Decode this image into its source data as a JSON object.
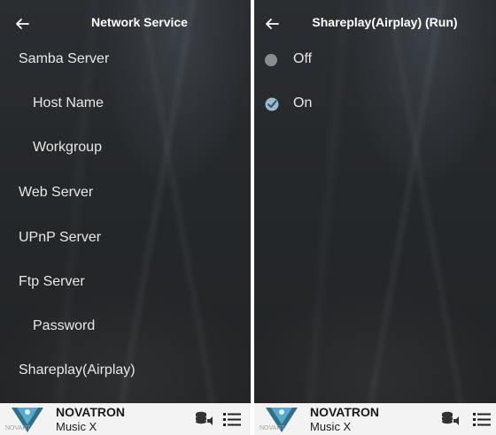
{
  "left_screen": {
    "title": "Network Service",
    "items": [
      {
        "label": "Samba Server"
      },
      {
        "label": "Host Name"
      },
      {
        "label": "Workgroup"
      },
      {
        "label": "Web Server"
      },
      {
        "label": "UPnP Server"
      },
      {
        "label": "Ftp Server"
      },
      {
        "label": "Password"
      },
      {
        "label": "Shareplay(Airplay)"
      }
    ]
  },
  "right_screen": {
    "title": "Shareplay(Airplay) (Run)",
    "options": [
      {
        "label": "Off",
        "selected": false
      },
      {
        "label": "On",
        "selected": true
      }
    ]
  },
  "player": {
    "title": "NOVATRON",
    "artist": "Music X",
    "art_text": "NOVART"
  },
  "icons": {
    "back": "back-arrow-icon",
    "database": "database-speaker-icon",
    "menu": "list-menu-icon",
    "radio_off": "radio-off-icon",
    "radio_on": "check-circle-icon"
  },
  "colors": {
    "background": "#25282b",
    "text": "#e8e8e8",
    "accent": "#4fb3d9",
    "player_bar": "#f3f3f3"
  }
}
